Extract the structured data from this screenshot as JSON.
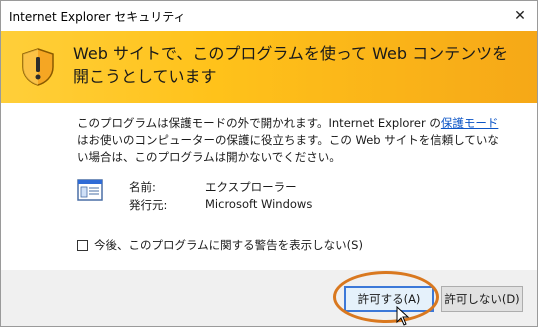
{
  "window": {
    "title": "Internet Explorer セキュリティ"
  },
  "banner": {
    "message": "Web サイトで、このプログラムを使って Web コンテンツを開こうとしています"
  },
  "description": {
    "part1": "このプログラムは保護モードの外で開かれます。Internet Explorer の",
    "link": "保護モード",
    "part2": "はお使いのコンピューターの保護に役立ちます。この Web サイトを信頼していない場合は、このプログラムは開かないでください。"
  },
  "program": {
    "name_label": "名前:",
    "name_value": "エクスプローラー",
    "publisher_label": "発行元:",
    "publisher_value": "Microsoft Windows"
  },
  "checkbox": {
    "label": "今後、このプログラムに関する警告を表示しない(S)",
    "checked": false
  },
  "buttons": {
    "allow": "許可する(A)",
    "deny": "許可しない(D)"
  },
  "colors": {
    "banner": "#ffc21a",
    "annotation": "#d9781f",
    "link": "#0b54c6"
  },
  "icons": [
    "shield-warning-icon",
    "application-icon",
    "close-icon",
    "mouse-cursor-icon"
  ]
}
